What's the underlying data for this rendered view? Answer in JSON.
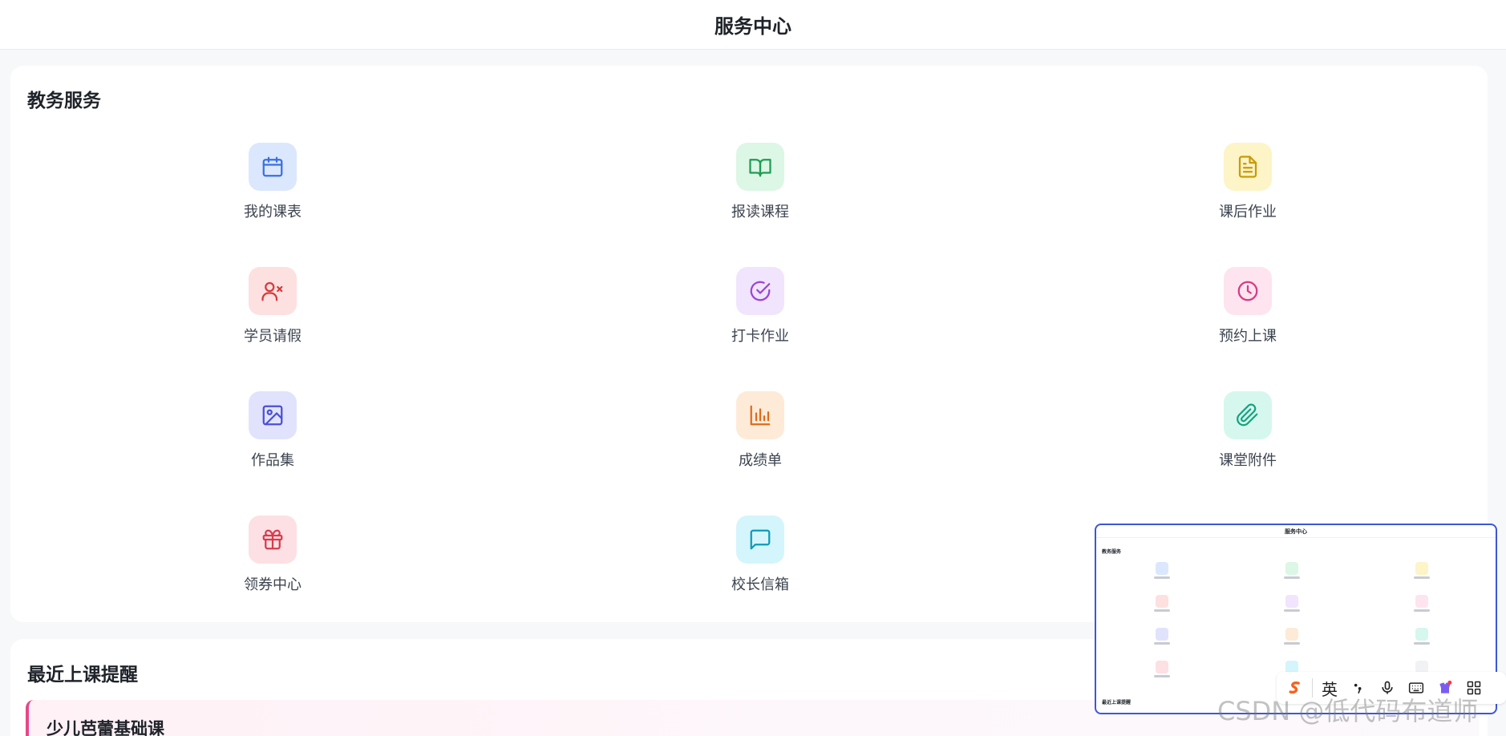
{
  "header": {
    "title": "服务中心"
  },
  "services": {
    "title": "教务服务",
    "items": [
      {
        "label": "我的课表",
        "icon": "calendar-icon",
        "color": "#3b6fe0",
        "bg": "#dbe7fd"
      },
      {
        "label": "报读课程",
        "icon": "book-open-icon",
        "color": "#1f9d55",
        "bg": "#dcf7e5"
      },
      {
        "label": "课后作业",
        "icon": "document-icon",
        "color": "#c99a06",
        "bg": "#fdf4c7"
      },
      {
        "label": "学员请假",
        "icon": "user-x-icon",
        "color": "#d63b3b",
        "bg": "#fde0e0"
      },
      {
        "label": "打卡作业",
        "icon": "check-circle-icon",
        "color": "#9a45d6",
        "bg": "#f1e4fd"
      },
      {
        "label": "预约上课",
        "icon": "clock-icon",
        "color": "#d63a85",
        "bg": "#fde4ef"
      },
      {
        "label": "作品集",
        "icon": "image-icon",
        "color": "#4a4fd6",
        "bg": "#e1e3fd"
      },
      {
        "label": "成绩单",
        "icon": "bar-chart-icon",
        "color": "#e06a1c",
        "bg": "#fdebd8"
      },
      {
        "label": "课堂附件",
        "icon": "paperclip-icon",
        "color": "#14a37f",
        "bg": "#d6f7ee"
      },
      {
        "label": "领券中心",
        "icon": "gift-icon",
        "color": "#d63b4e",
        "bg": "#fde0e3"
      },
      {
        "label": "校长信箱",
        "icon": "message-icon",
        "color": "#0e9bb8",
        "bg": "#d4f5fb"
      }
    ]
  },
  "reminder": {
    "title": "最近上课提醒",
    "course": "少儿芭蕾基础课",
    "accent": "#e8468a"
  },
  "preview": {
    "title": "服务中心",
    "section_title": "教务服务",
    "section2_title": "最近上课提醒"
  },
  "ime": {
    "lang": "英",
    "icons": [
      "sogou-logo-icon",
      "punctuation-icon",
      "microphone-icon",
      "keyboard-icon",
      "skin-icon",
      "grid-icon"
    ]
  },
  "watermark": "CSDN @低代码布道师"
}
